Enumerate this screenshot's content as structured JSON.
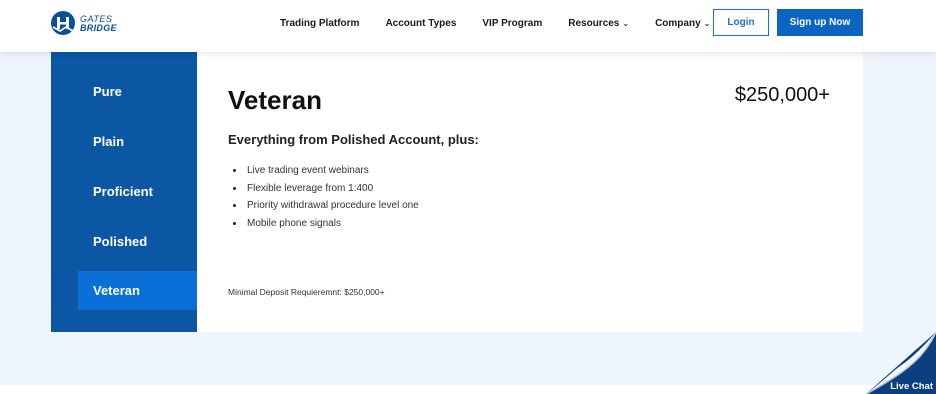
{
  "brand": {
    "line1": "GATES",
    "line2": "BRIDGE",
    "color": "#0a4f9a"
  },
  "nav": {
    "items": [
      {
        "label": "Trading Platform",
        "dropdown": false
      },
      {
        "label": "Account Types",
        "dropdown": false
      },
      {
        "label": "VIP Program",
        "dropdown": false
      },
      {
        "label": "Resources",
        "dropdown": true
      },
      {
        "label": "Company",
        "dropdown": true
      }
    ],
    "login_label": "Login",
    "signup_label": "Sign up Now"
  },
  "sidebar": {
    "items": [
      {
        "label": "Pure",
        "active": false
      },
      {
        "label": "Plain",
        "active": false
      },
      {
        "label": "Proficient",
        "active": false
      },
      {
        "label": "Polished",
        "active": false
      },
      {
        "label": "Veteran",
        "active": true
      }
    ]
  },
  "account": {
    "title": "Veteran",
    "price": "$250,000+",
    "subtitle": "Everything from Polished Account, plus:",
    "features": [
      "Live trading event webinars",
      "Flexible leverage from 1:400",
      "Priority withdrawal procedure level one",
      "Mobile phone signals"
    ],
    "min_deposit": "Minimal Deposit Requieremnt: $250,000+"
  },
  "live_chat": {
    "label": "Live Chat"
  },
  "colors": {
    "sidebar_bg": "#0b57a4",
    "sidebar_active": "#0a6fd6",
    "primary_button": "#0b63c2",
    "section_bg": "#eef5fd"
  }
}
